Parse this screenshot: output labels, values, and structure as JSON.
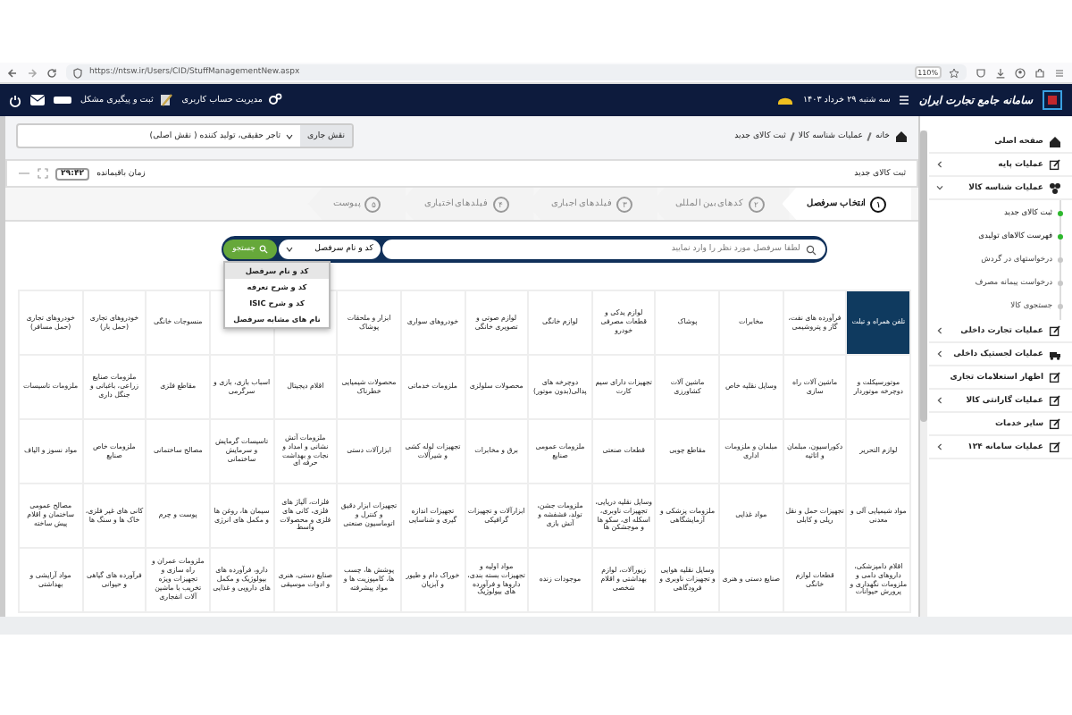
{
  "browser": {
    "url": "https://ntsw.ir/Users/CID/StuffManagementNew.aspx",
    "zoom": "110%"
  },
  "header": {
    "logo_text": "سامانه جامع تجارت ایران",
    "date": "سه شنبه ۲۹ خرداد ۱۴۰۳",
    "links": [
      "مدیریت حساب کاربری",
      "ثبت و پیگیری مشکل"
    ]
  },
  "breadcrumb": [
    "خانه",
    "عملیات شناسه کالا",
    "ثبت کالای جدید"
  ],
  "role": {
    "label": "نقش جاری",
    "value": "تاجر حقیقی، تولید کننده ( نقش اصلی)"
  },
  "page_title": "ثبت کالای جدید",
  "timer": {
    "label": "زمان باقیمانده",
    "value": "۲۹:۴۲"
  },
  "steps": [
    {
      "number": "۱",
      "label": "انتخاب سرفصل",
      "selected": true
    },
    {
      "number": "۲",
      "label": "کدهای بین المللی",
      "selected": false
    },
    {
      "number": "۳",
      "label": "فیلدهای اجباری",
      "selected": false
    },
    {
      "number": "۴",
      "label": "فیلدهای اختیاری",
      "selected": false
    },
    {
      "number": "۵",
      "label": "پیوست",
      "selected": false
    }
  ],
  "search": {
    "placeholder": "لطفا سرفصل مورد نظر را وارد نمایید",
    "filter": "کد و نام سرفصل",
    "button": "جستجو",
    "options": [
      {
        "label": "کد و نام سرفصل",
        "selected": true
      },
      {
        "label": "کد و شرح تعرفه",
        "selected": false
      },
      {
        "label": "کد و شرح ISIC",
        "selected": false
      },
      {
        "label": "نام های مشابه سرفصل",
        "selected": false
      }
    ]
  },
  "categories": [
    [
      {
        "label": "تلفن همراه و تبلت",
        "selected": true
      },
      {
        "label": "فرآورده های نفت، گاز و پتروشیمی",
        "selected": false
      },
      {
        "label": "مخابرات",
        "selected": false
      },
      {
        "label": "پوشاک",
        "selected": false
      },
      {
        "label": "لوازم یدکی و قطعات مصرفی خودرو",
        "selected": false
      },
      {
        "label": "لوازم خانگی",
        "selected": false
      },
      {
        "label": "لوازم صوتی و تصویری خانگی",
        "selected": false
      },
      {
        "label": "خودروهای سواری",
        "selected": false
      },
      {
        "label": "ابزار و ملحقات پوشاک",
        "selected": false
      },
      {
        "selected": false
      },
      {
        "selected": false
      },
      {
        "label": "منسوجات خانگی",
        "selected": false
      },
      {
        "label": "خودروهای تجاری (حمل بار)",
        "selected": false
      },
      {
        "label": "خودروهای تجاری (حمل مسافر)",
        "selected": false
      }
    ],
    [
      {
        "label": "موتورسیکلت و دوچرخه موتوردار",
        "selected": false
      },
      {
        "label": "ماشین آلات راه سازی",
        "selected": false
      },
      {
        "label": "وسایل نقلیه خاص",
        "selected": false
      },
      {
        "label": "ماشین آلات کشاورزی",
        "selected": false
      },
      {
        "label": "تجهیزات دارای سیم کارت",
        "selected": false
      },
      {
        "label": "دوچرخه های پدالی(بدون موتور)",
        "selected": false
      },
      {
        "label": "محصولات سلولزی",
        "selected": false
      },
      {
        "label": "ملزومات خدماتی",
        "selected": false
      },
      {
        "label": "محصولات شیمیایی خطرناک",
        "selected": false
      },
      {
        "label": "اقلام دیجیتال",
        "selected": false
      },
      {
        "label": "اسباب بازی، بازی و سرگرمی",
        "selected": false
      },
      {
        "label": "مقاطع فلزی",
        "selected": false
      },
      {
        "label": "ملزومات صنایع زراعی، باغبانی و جنگل داری",
        "selected": false
      },
      {
        "label": "ملزومات تاسیسات",
        "selected": false
      }
    ],
    [
      {
        "label": "لوازم التحریر",
        "selected": false
      },
      {
        "label": "دکوراسیون، مبلمان و اثاثیه",
        "selected": false
      },
      {
        "label": "مبلمان و ملزومات اداری",
        "selected": false
      },
      {
        "label": "مقاطع چوبی",
        "selected": false
      },
      {
        "label": "قطعات صنعتی",
        "selected": false
      },
      {
        "label": "ملزومات عمومی صنایع",
        "selected": false
      },
      {
        "label": "برق و مخابرات",
        "selected": false
      },
      {
        "label": "تجهیزات لوله کشی و شیرآلات",
        "selected": false
      },
      {
        "label": "ابزارآلات دستی",
        "selected": false
      },
      {
        "label": "ملزومات آتش نشانی و امداد و نجات و بهداشت حرفه ای",
        "selected": false
      },
      {
        "label": "تاسیسات گرمایش و سرمایش ساختمانی",
        "selected": false
      },
      {
        "label": "مصالح ساختمانی",
        "selected": false
      },
      {
        "label": "ملزومات خاص صنایع",
        "selected": false
      },
      {
        "label": "مواد نسوز و الیاف",
        "selected": false
      }
    ],
    [
      {
        "label": "مواد شیمیایی آلی و معدنی",
        "selected": false
      },
      {
        "label": "تجهیزات حمل و نقل ریلی و کابلی",
        "selected": false
      },
      {
        "label": "مواد غذایی",
        "selected": false
      },
      {
        "label": "ملزومات پزشکی و آزمایشگاهی",
        "selected": false
      },
      {
        "label": "وسایل نقلیه دریایی، تجهیزات ناوبری، اسکله ای، سکو ها و موجشکن ها",
        "selected": false
      },
      {
        "label": "ملزومات جشن، تولد، فشفشه و آتش بازی",
        "selected": false
      },
      {
        "label": "ابزارآلات و تجهیزات گرافیکی",
        "selected": false
      },
      {
        "label": "تجهیزات اندازه گیری و شناسایی",
        "selected": false
      },
      {
        "label": "تجهیزات ابزار دقیق و کنترل و اتوماسیون صنعتی",
        "selected": false
      },
      {
        "label": "فلزات، آلیاژ های فلزی، کانی های فلزی و محصولات واسط",
        "selected": false
      },
      {
        "label": "سیمان ها، روغن ها و مکمل های انرژی",
        "selected": false
      },
      {
        "label": "پوست و چرم",
        "selected": false
      },
      {
        "label": "کانی های غیر فلزی، خاک ها و سنگ ها",
        "selected": false
      },
      {
        "label": "مصالح عمومی ساختمان و اقلام پیش ساخته",
        "selected": false
      }
    ],
    [
      {
        "label": "اقلام دامپزشکی، داروهای دامی و ملزومات نگهداری و پرورش حیوانات",
        "selected": false
      },
      {
        "label": "قطعات لوازم خانگی",
        "selected": false
      },
      {
        "label": "صنایع دستی و هنری",
        "selected": false
      },
      {
        "label": "وسایل نقلیه هوایی و تجهیزات ناوبری و فرودگاهی",
        "selected": false
      },
      {
        "label": "زیورآلات، لوازم بهداشتی و اقلام شخصی",
        "selected": false
      },
      {
        "label": "موجودات زنده",
        "selected": false
      },
      {
        "label": "مواد اولیه و تجهیزات بسته بندی، داروها و فرآورده های بیولوژیک",
        "selected": false
      },
      {
        "label": "خوراک دام و طیور و آبزیان",
        "selected": false
      },
      {
        "label": "پوشش ها، چسب ها، کامپوزیت ها و مواد پیشرفته",
        "selected": false
      },
      {
        "label": "صنایع دستی، هنری و ادوات موسیقی",
        "selected": false
      },
      {
        "label": "دارو، فرآورده های بیولوژیک و مکمل های دارویی و غذایی",
        "selected": false
      },
      {
        "label": "ملزومات عمران و راه سازی و تجهیزات ویژه تخریب با ماشین آلات انفجاری",
        "selected": false
      },
      {
        "label": "فرآورده های گیاهی و حیوانی",
        "selected": false
      },
      {
        "label": "مواد آرایشی و بهداشتی",
        "selected": false
      }
    ]
  ],
  "sidebar": [
    {
      "label": "صفحه اصلی"
    },
    {
      "label": "عملیات پایه",
      "expanded": false
    },
    {
      "label": "عملیات شناسه کالا",
      "expanded": true,
      "children": [
        {
          "label": "ثبت کالای جدید",
          "active": true
        },
        {
          "label": "فهرست کالاهای تولیدی",
          "active": true
        },
        {
          "label": "درخواستهای در گردش",
          "active": false
        },
        {
          "label": "درخواست پیمانه مصرف",
          "active": false
        },
        {
          "label": "جستجوی کالا",
          "active": false
        }
      ]
    },
    {
      "label": "عملیات تجارت داخلی",
      "expanded": false
    },
    {
      "label": "عملیات لجستیک داخلی",
      "expanded": false
    },
    {
      "label": "اظهار استعلامات تجاری"
    },
    {
      "label": "عملیات گارانتی کالا",
      "expanded": false
    },
    {
      "label": "سایر خدمات"
    },
    {
      "label": "عملیات سامانه ۱۲۴",
      "expanded": false
    }
  ]
}
